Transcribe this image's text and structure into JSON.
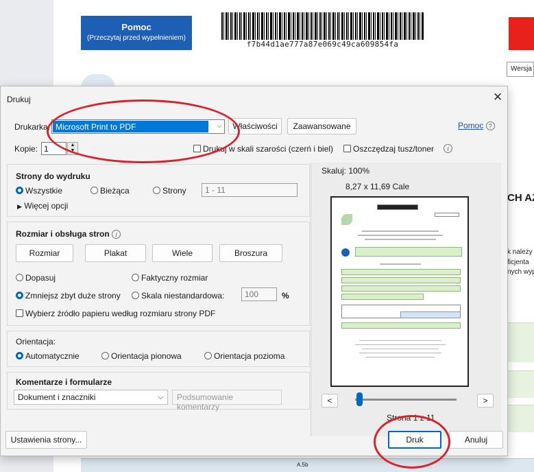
{
  "background_doc": {
    "help_button": {
      "title": "Pomoc",
      "subtitle": "(Przeczytaj przed wypełnieniem)"
    },
    "barcode_text": "f7b44d1ae777a87e069c49ca609854fa",
    "version_label": "Wersja",
    "heading_fragment": "CH AZ",
    "text_fragments": [
      "k należy",
      "ficjenta",
      "nych wyp"
    ],
    "footer_label": "A.5b"
  },
  "dialog": {
    "title": "Drukuj",
    "close_glyph": "✕",
    "printer": {
      "label": "Drukarka:",
      "selected": "Microsoft Print to PDF",
      "properties_label": "Właściwości",
      "advanced_label": "Zaawansowane"
    },
    "help_link": "Pomoc",
    "help_glyph": "?",
    "copies": {
      "label": "Kopie:",
      "value": "1"
    },
    "grayscale_label": "Drukuj w skali szarości (czerń i biel)",
    "save_ink_label": "Oszczędzaj tusz/toner",
    "pages": {
      "title": "Strony do wydruku",
      "all": "Wszystkie",
      "current": "Bieżąca",
      "pages": "Strony",
      "range_placeholder": "1 - 11",
      "more_options": "Więcej opcji"
    },
    "sizing": {
      "title": "Rozmiar i obsługa stron",
      "size_button": "Rozmiar",
      "poster_button": "Plakat",
      "multiple_button": "Wiele",
      "booklet_button": "Broszura",
      "fit": "Dopasuj",
      "actual_size": "Faktyczny rozmiar",
      "shrink": "Zmniejsz zbyt duże strony",
      "custom_scale": "Skala niestandardowa:",
      "scale_value": "100",
      "percent": "%",
      "paper_source": "Wybierz źródło papieru według rozmiaru strony PDF"
    },
    "orientation": {
      "title": "Orientacja:",
      "auto": "Automatycznie",
      "portrait": "Orientacja pionowa",
      "landscape": "Orientacja pozioma"
    },
    "comments": {
      "title": "Komentarze i formularze",
      "selected": "Dokument i znaczniki",
      "summarize": "Podsumowanie komentarzy"
    },
    "preview": {
      "scale": "Skaluj: 100%",
      "size": "8,27 x 11,69 Cale",
      "page_indicator": "Strona 1 z 11",
      "prev": "<",
      "next": ">"
    },
    "page_setup_label": "Ustawienia strony...",
    "print_label": "Druk",
    "cancel_label": "Anuluj"
  },
  "colors": {
    "accent": "#0067c0",
    "selection": "#0078d7",
    "annotation": "#d8232a",
    "help_box": "#1d5fb5"
  }
}
